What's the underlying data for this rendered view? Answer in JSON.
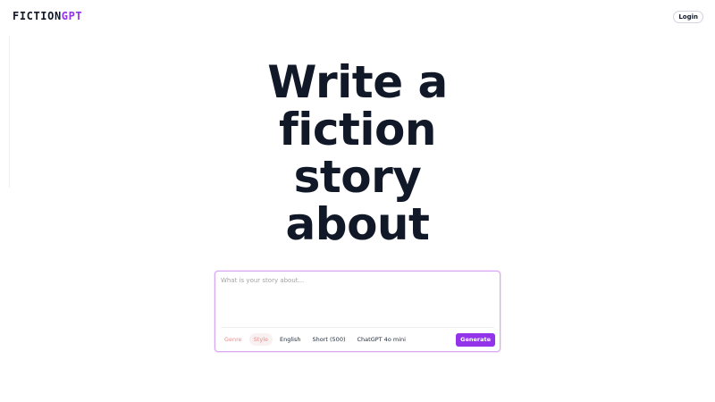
{
  "header": {
    "logo_part1": "FICTION",
    "logo_part2": "GPT",
    "login_label": "Login"
  },
  "hero": {
    "lines": [
      "Write a",
      "fiction",
      "story",
      "about"
    ]
  },
  "prompt": {
    "placeholder": "What is your story about...",
    "value": ""
  },
  "options": {
    "genre": "Genre",
    "style": "Style",
    "language": "English",
    "length": "Short (500)",
    "model": "ChatGPT 4o mini"
  },
  "generate_label": "Generate",
  "colors": {
    "accent": "#9333ea",
    "card_border": "#d8a8f2",
    "text": "#111827",
    "muted_option": "#ec8b8b"
  }
}
